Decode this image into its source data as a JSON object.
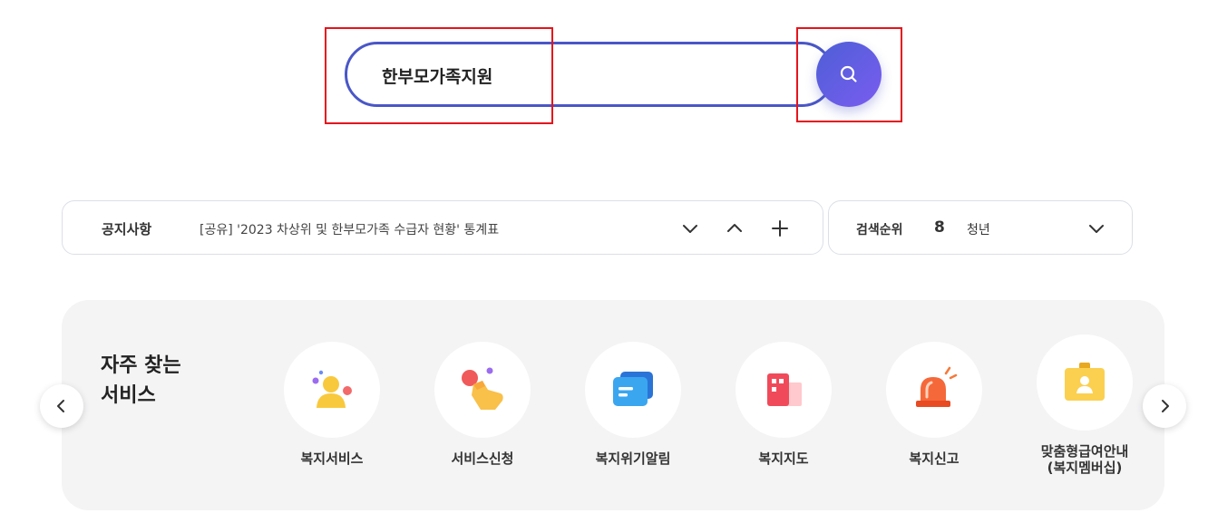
{
  "search": {
    "query": "한부모가족지원",
    "button_icon": "search-icon",
    "accent_gradient": [
      "#4d5fd6",
      "#7a5cf0"
    ],
    "border_color": "#4a57c7"
  },
  "annotations": {
    "highlight_color": "#e5141c"
  },
  "notice": {
    "label": "공지사항",
    "text": "[공유] '2023 차상위 및 한부모가족 수급자 현황' 통계표",
    "controls": [
      "chevron-down-icon",
      "chevron-up-icon",
      "plus-icon"
    ]
  },
  "ranking": {
    "label": "검색순위",
    "number": "8",
    "keyword": "청년",
    "toggle_icon": "chevron-down-icon"
  },
  "services": {
    "title_line1": "자주 찾는",
    "title_line2": "서비스",
    "items": [
      {
        "label": "복지서비스",
        "icon": "person-icon"
      },
      {
        "label": "서비스신청",
        "icon": "hand-pointer-icon"
      },
      {
        "label": "복지위기알림",
        "icon": "message-icon"
      },
      {
        "label": "복지지도",
        "icon": "building-icon"
      },
      {
        "label": "복지신고",
        "icon": "siren-icon"
      },
      {
        "label": "맞춤형급여안내",
        "label2": "(복지멤버십)",
        "icon": "id-badge-icon"
      }
    ],
    "prev_icon": "chevron-left-icon",
    "next_icon": "chevron-right-icon"
  }
}
